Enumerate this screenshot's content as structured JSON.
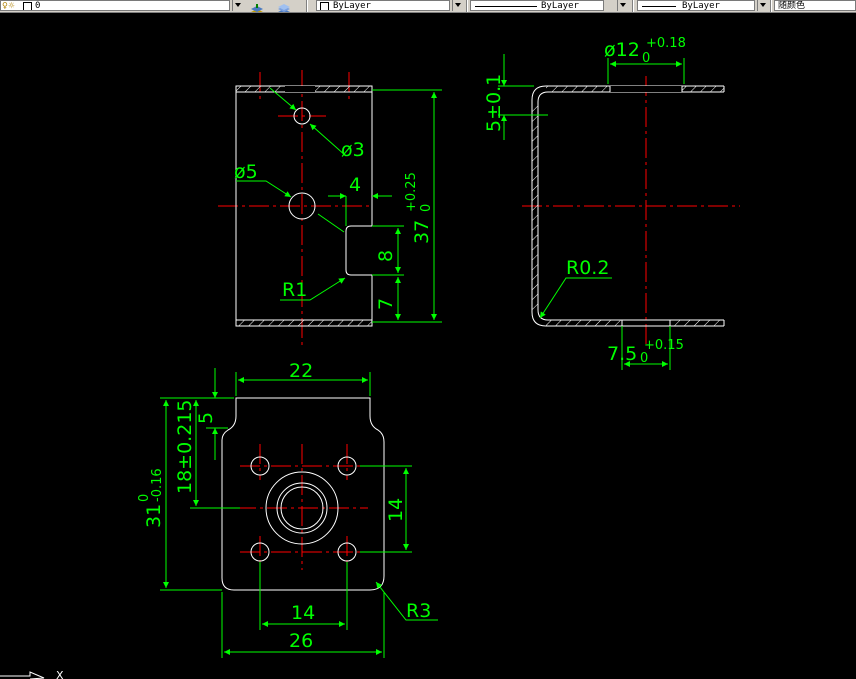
{
  "toolbar": {
    "layer_value": "0",
    "color_value": "ByLayer",
    "linetype_value": "ByLayer",
    "lineweight_value": "ByLayer",
    "plotstyle_value": "随颜色"
  },
  "colors": {
    "background": "#000000",
    "geometry": "#ffffff",
    "dimension": "#00ff00",
    "centerline": "#ff0000"
  },
  "drawing": {
    "front_view": {
      "dia3": "ø3",
      "dia5": "ø5",
      "dim4": "4",
      "dim8": "8",
      "dim7": "7",
      "r1": "R1",
      "dim37": "37",
      "dim37_tol_upper": "+0.25",
      "dim37_tol_lower": "0"
    },
    "side_view": {
      "dia12": "ø12",
      "dia12_tol_upper": "+0.18",
      "dia12_tol_lower": "0",
      "dim5": "5±0.1",
      "r02": "R0.2",
      "dim75": "7.5",
      "dim75_tol_upper": "+0.15",
      "dim75_tol_lower": "0"
    },
    "bottom_view": {
      "dim22": "22",
      "dim5": "5",
      "dim18": "18±0.215",
      "dim31": "31",
      "dim31_tol_upper": "0",
      "dim31_tol_lower": "-0.16",
      "dim14_vert": "14",
      "dim14_horz": "14",
      "dim26": "26",
      "r3": "R3"
    },
    "ucs_label": "X"
  }
}
